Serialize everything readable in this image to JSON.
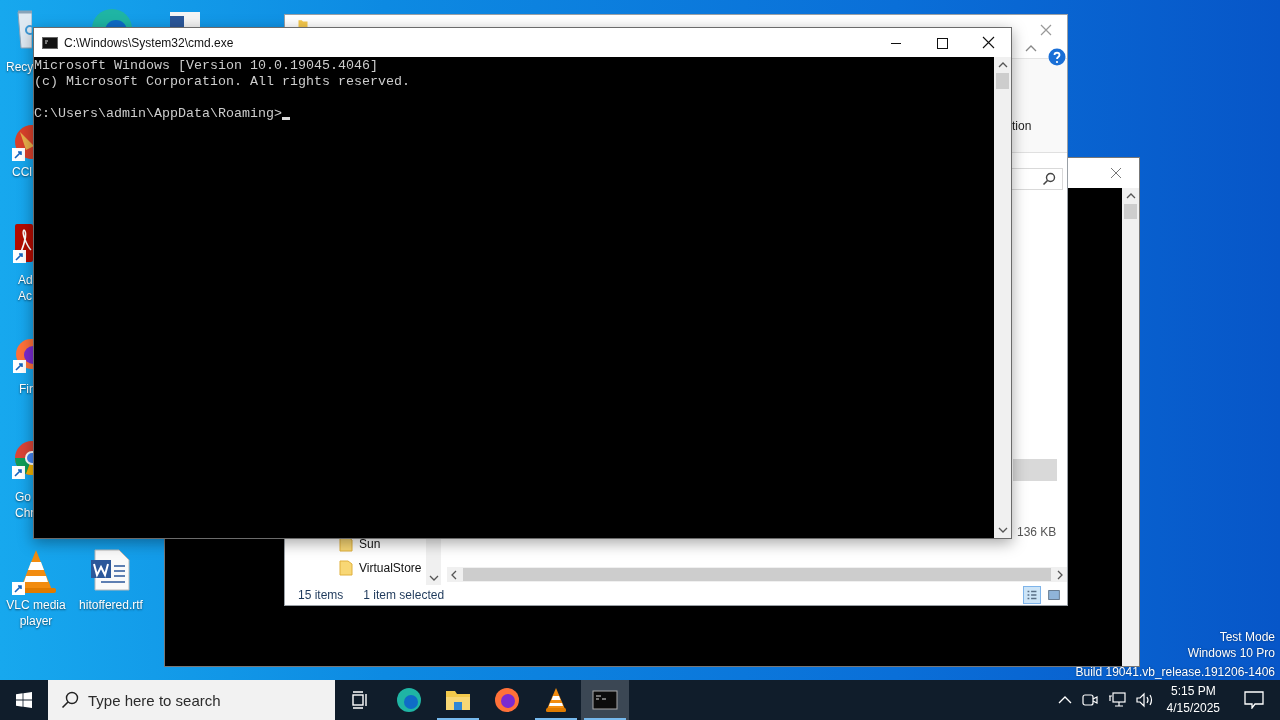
{
  "desktop_icons": [
    {
      "kind": "recycle-bin",
      "lines": [
        "Recy"
      ]
    },
    {
      "kind": "edge"
    },
    {
      "kind": "document"
    },
    {
      "kind": "ccleaner",
      "lines": [
        "CCl"
      ]
    },
    {
      "kind": "acrobat",
      "lines": [
        "Ad",
        "Ac"
      ]
    },
    {
      "kind": "firefox",
      "lines": [
        "Fir"
      ]
    },
    {
      "kind": "chrome",
      "lines": [
        "Go",
        "Chr"
      ]
    },
    {
      "kind": "vlc",
      "lines": [
        "VLC media",
        "player"
      ]
    },
    {
      "kind": "word",
      "lines": [
        "hitoffered.rtf"
      ]
    }
  ],
  "explorer_window": {
    "ribbon_fragments": [
      "tion"
    ],
    "file_size": "136 KB",
    "nav_items": [
      {
        "label": "Sun"
      },
      {
        "label": "VirtualStore"
      }
    ],
    "status_bar": {
      "item_count": "15 items",
      "selection": "1 item selected"
    },
    "view_buttons": [
      {
        "kind": "details",
        "selected": true
      },
      {
        "kind": "large-icons",
        "selected": false
      }
    ]
  },
  "cmd_window": {
    "title": "C:\\Windows\\System32\\cmd.exe",
    "output": [
      "Microsoft Windows [Version 10.0.19045.4046]",
      "(c) Microsoft Corporation. All rights reserved."
    ],
    "prompt": "C:\\Users\\admin\\AppData\\Roaming>"
  },
  "watermark": [
    "Test Mode",
    "Windows 10 Pro",
    "Build 19041.vb_release.191206-1406"
  ],
  "taskbar": {
    "search": {
      "placeholder": "Type here to search"
    },
    "apps": [
      {
        "kind": "edge",
        "running": false,
        "active": false
      },
      {
        "kind": "explorer",
        "running": true,
        "active": false
      },
      {
        "kind": "firefox",
        "running": false,
        "active": false
      },
      {
        "kind": "vlc",
        "running": true,
        "active": false
      },
      {
        "kind": "cmd",
        "running": true,
        "active": true
      }
    ],
    "clock": {
      "time": "5:15 PM",
      "date": "4/15/2025"
    }
  }
}
